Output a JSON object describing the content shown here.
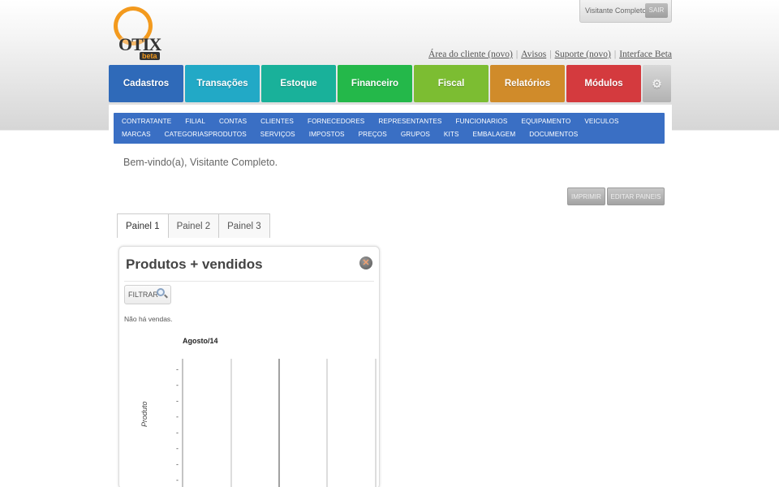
{
  "header": {
    "logo_text": "OTIX",
    "logo_tag": "beta",
    "user_name": "Visitante Completo",
    "sair_label": "SAIR",
    "links": [
      "Área do cliente (novo)",
      "Avisos",
      "Suporte (novo)",
      "Interface Beta"
    ]
  },
  "mainnav": [
    {
      "label": "Cadastros",
      "color": "#2f6ab9"
    },
    {
      "label": "Transações",
      "color": "#22a9c6"
    },
    {
      "label": "Estoque",
      "color": "#19b19a"
    },
    {
      "label": "Financeiro",
      "color": "#24b84a"
    },
    {
      "label": "Fiscal",
      "color": "#7cbd32"
    },
    {
      "label": "Relatórios",
      "color": "#d08b2a"
    },
    {
      "label": "Módulos",
      "color": "#d43a3e"
    }
  ],
  "gear_icon": "gear-icon",
  "subnav": [
    "CONTRATANTE",
    "FILIAL",
    "CONTAS",
    "CLIENTES",
    "FORNECEDORES",
    "REPRESENTANTES",
    "FUNCIONARIOS",
    "EQUIPAMENTO",
    "VEICULOS",
    "MARCAS",
    "CATEGORIAS",
    "PRODUTOS",
    "SERVIÇOS",
    "IMPOSTOS",
    "PREÇOS",
    "GRUPOS",
    "KITS",
    "EMBALAGEM",
    "DOCUMENTOS"
  ],
  "welcome": "Bem-vindo(a), Visitante Completo.",
  "buttons": {
    "imprimir": "IMPRIMIR",
    "editar_paineis": "EDITAR PAINEIS"
  },
  "panel_tabs": [
    "Painel 1",
    "Painel 2",
    "Painel 3"
  ],
  "active_tab": "Painel 1",
  "widget": {
    "title": "Produtos + vendidos",
    "filter_label": "FILTRAR",
    "empty_text": "Não há vendas.",
    "chart_period": "Agosto/14",
    "y_axis_label": "Produto",
    "y_tick_label": "-"
  }
}
